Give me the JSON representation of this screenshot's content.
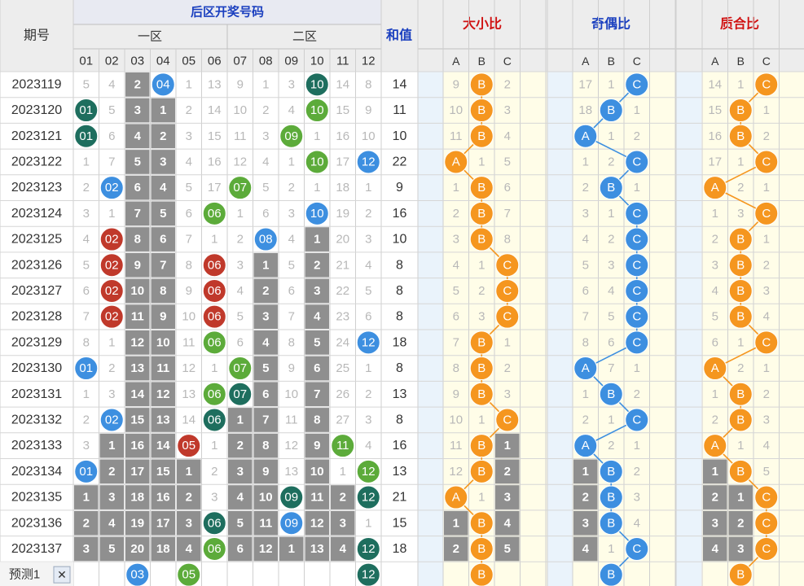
{
  "chart_data": {
    "type": "table",
    "header": {
      "period": "期号",
      "back_title": "后区开奖号码",
      "zone1": "一区",
      "zone2": "二区",
      "sum": "和值",
      "size": "大小比",
      "parity": "奇偶比",
      "prime": "质合比",
      "numbers": [
        "01",
        "02",
        "03",
        "04",
        "05",
        "06",
        "07",
        "08",
        "09",
        "10",
        "11",
        "12"
      ],
      "abc": [
        "A",
        "B",
        "C"
      ]
    },
    "rows": [
      {
        "period": "2023119",
        "nums": [
          "5",
          "4",
          "2",
          "04",
          "1",
          "13",
          "9",
          "1",
          "3",
          "10",
          "14",
          "8"
        ],
        "sum": "14",
        "size": [
          "9",
          "B",
          "2"
        ],
        "parity": [
          "17",
          "1",
          "C"
        ],
        "prime": [
          "14",
          "1",
          "C"
        ]
      },
      {
        "period": "2023120",
        "nums": [
          "01",
          "5",
          "3",
          "1",
          "2",
          "14",
          "10",
          "2",
          "4",
          "10",
          "15",
          "9"
        ],
        "sum": "11",
        "size": [
          "10",
          "B",
          "3"
        ],
        "parity": [
          "18",
          "B",
          "1"
        ],
        "prime": [
          "15",
          "B",
          "1"
        ]
      },
      {
        "period": "2023121",
        "nums": [
          "01",
          "6",
          "4",
          "2",
          "3",
          "15",
          "11",
          "3",
          "09",
          "1",
          "16",
          "10"
        ],
        "sum": "10",
        "size": [
          "11",
          "B",
          "4"
        ],
        "parity": [
          "A",
          "1",
          "2"
        ],
        "prime": [
          "16",
          "B",
          "2"
        ]
      },
      {
        "period": "2023122",
        "nums": [
          "1",
          "7",
          "5",
          "3",
          "4",
          "16",
          "12",
          "4",
          "1",
          "10",
          "17",
          "12"
        ],
        "sum": "22",
        "size": [
          "A",
          "1",
          "5"
        ],
        "parity": [
          "1",
          "2",
          "C"
        ],
        "prime": [
          "17",
          "1",
          "C"
        ]
      },
      {
        "period": "2023123",
        "nums": [
          "2",
          "02",
          "6",
          "4",
          "5",
          "17",
          "07",
          "5",
          "2",
          "1",
          "18",
          "1"
        ],
        "sum": "9",
        "size": [
          "1",
          "B",
          "6"
        ],
        "parity": [
          "2",
          "B",
          "1"
        ],
        "prime": [
          "A",
          "2",
          "1"
        ]
      },
      {
        "period": "2023124",
        "nums": [
          "3",
          "1",
          "7",
          "5",
          "6",
          "06",
          "1",
          "6",
          "3",
          "10",
          "19",
          "2"
        ],
        "sum": "16",
        "size": [
          "2",
          "B",
          "7"
        ],
        "parity": [
          "3",
          "1",
          "C"
        ],
        "prime": [
          "1",
          "3",
          "C"
        ]
      },
      {
        "period": "2023125",
        "nums": [
          "4",
          "02",
          "8",
          "6",
          "7",
          "1",
          "2",
          "08",
          "4",
          "1",
          "20",
          "3"
        ],
        "sum": "10",
        "size": [
          "3",
          "B",
          "8"
        ],
        "parity": [
          "4",
          "2",
          "C"
        ],
        "prime": [
          "2",
          "B",
          "1"
        ]
      },
      {
        "period": "2023126",
        "nums": [
          "5",
          "02",
          "9",
          "7",
          "8",
          "06",
          "3",
          "1",
          "5",
          "2",
          "21",
          "4"
        ],
        "sum": "8",
        "size": [
          "4",
          "1",
          "C"
        ],
        "parity": [
          "5",
          "3",
          "C"
        ],
        "prime": [
          "3",
          "B",
          "2"
        ]
      },
      {
        "period": "2023127",
        "nums": [
          "6",
          "02",
          "10",
          "8",
          "9",
          "06",
          "4",
          "2",
          "6",
          "3",
          "22",
          "5"
        ],
        "sum": "8",
        "size": [
          "5",
          "2",
          "C"
        ],
        "parity": [
          "6",
          "4",
          "C"
        ],
        "prime": [
          "4",
          "B",
          "3"
        ]
      },
      {
        "period": "2023128",
        "nums": [
          "7",
          "02",
          "11",
          "9",
          "10",
          "06",
          "5",
          "3",
          "7",
          "4",
          "23",
          "6"
        ],
        "sum": "8",
        "size": [
          "6",
          "3",
          "C"
        ],
        "parity": [
          "7",
          "5",
          "C"
        ],
        "prime": [
          "5",
          "B",
          "4"
        ]
      },
      {
        "period": "2023129",
        "nums": [
          "8",
          "1",
          "12",
          "10",
          "11",
          "06",
          "6",
          "4",
          "8",
          "5",
          "24",
          "12"
        ],
        "sum": "18",
        "size": [
          "7",
          "B",
          "1"
        ],
        "parity": [
          "8",
          "6",
          "C"
        ],
        "prime": [
          "6",
          "1",
          "C"
        ]
      },
      {
        "period": "2023130",
        "nums": [
          "01",
          "2",
          "13",
          "11",
          "12",
          "1",
          "07",
          "5",
          "9",
          "6",
          "25",
          "1"
        ],
        "sum": "8",
        "size": [
          "8",
          "B",
          "2"
        ],
        "parity": [
          "A",
          "7",
          "1"
        ],
        "prime": [
          "A",
          "2",
          "1"
        ]
      },
      {
        "period": "2023131",
        "nums": [
          "1",
          "3",
          "14",
          "12",
          "13",
          "06",
          "07",
          "6",
          "10",
          "7",
          "26",
          "2"
        ],
        "sum": "13",
        "size": [
          "9",
          "B",
          "3"
        ],
        "parity": [
          "1",
          "B",
          "2"
        ],
        "prime": [
          "1",
          "B",
          "2"
        ]
      },
      {
        "period": "2023132",
        "nums": [
          "2",
          "02",
          "15",
          "13",
          "14",
          "06",
          "1",
          "7",
          "11",
          "8",
          "27",
          "3"
        ],
        "sum": "8",
        "size": [
          "10",
          "1",
          "C"
        ],
        "parity": [
          "2",
          "1",
          "C"
        ],
        "prime": [
          "2",
          "B",
          "3"
        ]
      },
      {
        "period": "2023133",
        "nums": [
          "3",
          "1",
          "16",
          "14",
          "05",
          "1",
          "2",
          "8",
          "12",
          "9",
          "11",
          "4"
        ],
        "sum": "16",
        "size": [
          "11",
          "B",
          "1"
        ],
        "parity": [
          "A",
          "2",
          "1"
        ],
        "prime": [
          "A",
          "1",
          "4"
        ]
      },
      {
        "period": "2023134",
        "nums": [
          "01",
          "2",
          "17",
          "15",
          "1",
          "2",
          "3",
          "9",
          "13",
          "10",
          "1",
          "12"
        ],
        "sum": "13",
        "size": [
          "12",
          "B",
          "2"
        ],
        "parity": [
          "1",
          "B",
          "2"
        ],
        "prime": [
          "1",
          "B",
          "5"
        ]
      },
      {
        "period": "2023135",
        "nums": [
          "1",
          "3",
          "18",
          "16",
          "2",
          "3",
          "4",
          "10",
          "09",
          "11",
          "2",
          "12"
        ],
        "sum": "21",
        "size": [
          "A",
          "1",
          "3"
        ],
        "parity": [
          "2",
          "B",
          "3"
        ],
        "prime": [
          "2",
          "1",
          "C"
        ]
      },
      {
        "period": "2023136",
        "nums": [
          "2",
          "4",
          "19",
          "17",
          "3",
          "06",
          "5",
          "11",
          "09",
          "12",
          "3",
          "1"
        ],
        "sum": "15",
        "size": [
          "1",
          "B",
          "4"
        ],
        "parity": [
          "3",
          "B",
          "4"
        ],
        "prime": [
          "3",
          "2",
          "C"
        ]
      },
      {
        "period": "2023137",
        "nums": [
          "3",
          "5",
          "20",
          "18",
          "4",
          "06",
          "6",
          "12",
          "1",
          "13",
          "4",
          "12"
        ],
        "sum": "18",
        "size": [
          "2",
          "B",
          "5"
        ],
        "parity": [
          "4",
          "1",
          "C"
        ],
        "prime": [
          "4",
          "3",
          "C"
        ]
      }
    ],
    "predict": {
      "label": "预测1",
      "close": "✕",
      "nums": [
        "",
        "",
        "03",
        "",
        "05",
        "",
        "",
        "",
        "",
        "",
        "",
        "12"
      ],
      "size": [
        "",
        "B",
        ""
      ],
      "parity": [
        "",
        "B",
        ""
      ],
      "prime": [
        "",
        "B",
        ""
      ]
    },
    "colors": {
      "blue": "#3d8fe0",
      "red": "#c0392b",
      "green": "#5cab3a",
      "teal": "#1e6e5e",
      "orange": "#f5961f",
      "gray_block": "#8f8f8f",
      "header_blue": "#1a3fbf",
      "header_red": "#d01010",
      "cream": "#fffde8",
      "light_blue": "#eaf3fb"
    },
    "ball_colors": {
      "01": "teal",
      "02": "blue",
      "04": "blue",
      "05": "red",
      "06": "green",
      "07": "green",
      "08": "blue",
      "09": "green",
      "10": "teal",
      "11": "green",
      "12": "blue",
      "03": "blue"
    },
    "ball_override": [
      {
        "row": 0,
        "col": 3,
        "color": "blue"
      },
      {
        "row": 0,
        "col": 9,
        "color": "teal"
      },
      {
        "row": 1,
        "col": 0,
        "color": "teal"
      },
      {
        "row": 1,
        "col": 9,
        "color": "green"
      },
      {
        "row": 2,
        "col": 0,
        "color": "teal"
      },
      {
        "row": 2,
        "col": 8,
        "color": "green"
      },
      {
        "row": 3,
        "col": 9,
        "color": "green"
      },
      {
        "row": 3,
        "col": 11,
        "color": "blue"
      },
      {
        "row": 4,
        "col": 1,
        "color": "blue"
      },
      {
        "row": 4,
        "col": 6,
        "color": "green"
      },
      {
        "row": 5,
        "col": 5,
        "color": "green"
      },
      {
        "row": 5,
        "col": 9,
        "color": "blue"
      },
      {
        "row": 6,
        "col": 1,
        "color": "red"
      },
      {
        "row": 6,
        "col": 7,
        "color": "blue"
      },
      {
        "row": 7,
        "col": 1,
        "color": "red"
      },
      {
        "row": 7,
        "col": 5,
        "color": "red"
      },
      {
        "row": 8,
        "col": 1,
        "color": "red"
      },
      {
        "row": 8,
        "col": 5,
        "color": "red"
      },
      {
        "row": 9,
        "col": 1,
        "color": "red"
      },
      {
        "row": 9,
        "col": 5,
        "color": "red"
      },
      {
        "row": 10,
        "col": 5,
        "color": "green"
      },
      {
        "row": 10,
        "col": 11,
        "color": "blue"
      },
      {
        "row": 11,
        "col": 0,
        "color": "blue"
      },
      {
        "row": 11,
        "col": 6,
        "color": "green"
      },
      {
        "row": 12,
        "col": 5,
        "color": "green"
      },
      {
        "row": 12,
        "col": 6,
        "color": "teal"
      },
      {
        "row": 13,
        "col": 1,
        "color": "blue"
      },
      {
        "row": 13,
        "col": 5,
        "color": "teal"
      },
      {
        "row": 14,
        "col": 4,
        "color": "red"
      },
      {
        "row": 14,
        "col": 10,
        "color": "green"
      },
      {
        "row": 15,
        "col": 0,
        "color": "blue"
      },
      {
        "row": 15,
        "col": 11,
        "color": "green"
      },
      {
        "row": 16,
        "col": 8,
        "color": "teal"
      },
      {
        "row": 16,
        "col": 11,
        "color": "teal"
      },
      {
        "row": 17,
        "col": 5,
        "color": "teal"
      },
      {
        "row": 17,
        "col": 8,
        "color": "blue"
      },
      {
        "row": 18,
        "col": 5,
        "color": "green"
      },
      {
        "row": 18,
        "col": 11,
        "color": "teal"
      },
      {
        "row": 19,
        "col": 2,
        "color": "blue"
      },
      {
        "row": 19,
        "col": 4,
        "color": "green"
      },
      {
        "row": 19,
        "col": 11,
        "color": "teal"
      }
    ],
    "gray_cells": [
      [
        0,
        2
      ],
      [
        1,
        2
      ],
      [
        1,
        3
      ],
      [
        2,
        2
      ],
      [
        2,
        3
      ],
      [
        3,
        2
      ],
      [
        3,
        3
      ],
      [
        4,
        2
      ],
      [
        4,
        3
      ],
      [
        5,
        2
      ],
      [
        5,
        3
      ],
      [
        6,
        2
      ],
      [
        6,
        3
      ],
      [
        6,
        9
      ],
      [
        7,
        2
      ],
      [
        7,
        3
      ],
      [
        7,
        7
      ],
      [
        7,
        9
      ],
      [
        8,
        2
      ],
      [
        8,
        3
      ],
      [
        8,
        7
      ],
      [
        8,
        9
      ],
      [
        9,
        2
      ],
      [
        9,
        3
      ],
      [
        9,
        7
      ],
      [
        9,
        9
      ],
      [
        10,
        2
      ],
      [
        10,
        3
      ],
      [
        10,
        7
      ],
      [
        10,
        9
      ],
      [
        11,
        2
      ],
      [
        11,
        3
      ],
      [
        11,
        7
      ],
      [
        11,
        9
      ],
      [
        12,
        2
      ],
      [
        12,
        3
      ],
      [
        12,
        7
      ],
      [
        12,
        9
      ],
      [
        13,
        2
      ],
      [
        13,
        3
      ],
      [
        13,
        6
      ],
      [
        13,
        7
      ],
      [
        13,
        9
      ],
      [
        14,
        1
      ],
      [
        14,
        2
      ],
      [
        14,
        3
      ],
      [
        14,
        6
      ],
      [
        14,
        7
      ],
      [
        14,
        9
      ],
      [
        15,
        1
      ],
      [
        15,
        2
      ],
      [
        15,
        3
      ],
      [
        15,
        4
      ],
      [
        15,
        6
      ],
      [
        15,
        7
      ],
      [
        15,
        9
      ],
      [
        16,
        0
      ],
      [
        16,
        1
      ],
      [
        16,
        2
      ],
      [
        16,
        3
      ],
      [
        16,
        4
      ],
      [
        16,
        6
      ],
      [
        16,
        7
      ],
      [
        16,
        9
      ],
      [
        16,
        10
      ],
      [
        17,
        0
      ],
      [
        17,
        1
      ],
      [
        17,
        2
      ],
      [
        17,
        3
      ],
      [
        17,
        4
      ],
      [
        17,
        6
      ],
      [
        17,
        7
      ],
      [
        17,
        9
      ],
      [
        17,
        10
      ],
      [
        18,
        0
      ],
      [
        18,
        1
      ],
      [
        18,
        2
      ],
      [
        18,
        3
      ],
      [
        18,
        4
      ],
      [
        18,
        6
      ],
      [
        18,
        7
      ],
      [
        18,
        8
      ],
      [
        18,
        9
      ],
      [
        18,
        10
      ]
    ],
    "gray_abc": {
      "size": [
        [
          14,
          2
        ],
        [
          15,
          2
        ],
        [
          16,
          2
        ],
        [
          17,
          0
        ],
        [
          17,
          2
        ],
        [
          18,
          0
        ],
        [
          18,
          2
        ]
      ],
      "parity": [
        [
          15,
          0
        ],
        [
          16,
          0
        ],
        [
          17,
          0
        ],
        [
          18,
          0
        ]
      ],
      "prime": [
        [
          15,
          0
        ],
        [
          16,
          0
        ],
        [
          16,
          1
        ],
        [
          17,
          0
        ],
        [
          17,
          1
        ],
        [
          18,
          0
        ],
        [
          18,
          1
        ]
      ]
    }
  }
}
